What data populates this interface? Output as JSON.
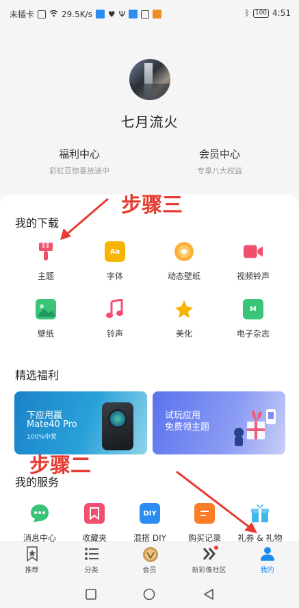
{
  "status_bar": {
    "carrier": "未插卡",
    "speed": "29.5K/s",
    "battery": "100",
    "time": "4:51"
  },
  "profile": {
    "nickname": "七月流火",
    "quick_links": [
      {
        "title": "福利中心",
        "subtitle": "彩虹豆惊喜放送中"
      },
      {
        "title": "会员中心",
        "subtitle": "专享八大权益"
      }
    ]
  },
  "downloads": {
    "title": "我的下载",
    "items": [
      {
        "label": "主题",
        "icon": "paint-brush-icon",
        "color": "#f0506e"
      },
      {
        "label": "字体",
        "icon": "font-icon",
        "color": "#f7b500"
      },
      {
        "label": "动态壁纸",
        "icon": "orange-disc-icon",
        "color": "#fbb03b"
      },
      {
        "label": "视频铃声",
        "icon": "video-camera-icon",
        "color": "#f0506e"
      },
      {
        "label": "壁纸",
        "icon": "landscape-icon",
        "color": "#39c47a"
      },
      {
        "label": "铃声",
        "icon": "music-note-icon",
        "color": "#f0506e"
      },
      {
        "label": "美化",
        "icon": "sparkle-star-icon",
        "color": "#f7b500"
      },
      {
        "label": "电子杂志",
        "icon": "magazine-icon",
        "color": "#39c47a"
      }
    ]
  },
  "welfare": {
    "title": "精选福利",
    "banners": [
      {
        "line1": "下应用赢",
        "line2": "Mate40 Pro",
        "line3": "100%中奖"
      },
      {
        "line1": "试玩应用",
        "line2": "免费领主题"
      }
    ]
  },
  "services": {
    "title": "我的服务",
    "items": [
      {
        "label": "消息中心",
        "icon": "chat-bubble-icon",
        "color": "#39c47a"
      },
      {
        "label": "收藏夹",
        "icon": "bookmark-icon",
        "color": "#f0506e"
      },
      {
        "label": "混搭 DIY",
        "icon": "diy-icon",
        "color": "#2d8cf0"
      },
      {
        "label": "购买记录",
        "icon": "receipt-icon",
        "color": "#fb7d28"
      },
      {
        "label": "礼券 & 礼物",
        "icon": "gift-icon",
        "color": "#41b6ea"
      }
    ]
  },
  "annotations": {
    "step3": "步骤三",
    "step2": "步骤二"
  },
  "bottom_nav": [
    {
      "label": "推荐",
      "icon": "star-badge-icon",
      "active": false
    },
    {
      "label": "分类",
      "icon": "list-icon",
      "active": false
    },
    {
      "label": "会员",
      "icon": "vip-medal-icon",
      "active": false
    },
    {
      "label": "新彩像社区",
      "icon": "community-chevrons-icon",
      "active": false
    },
    {
      "label": "我的",
      "icon": "person-icon",
      "active": true
    }
  ],
  "colors": {
    "accent": "#1b8cf0",
    "annotation_red": "#e53b30"
  }
}
